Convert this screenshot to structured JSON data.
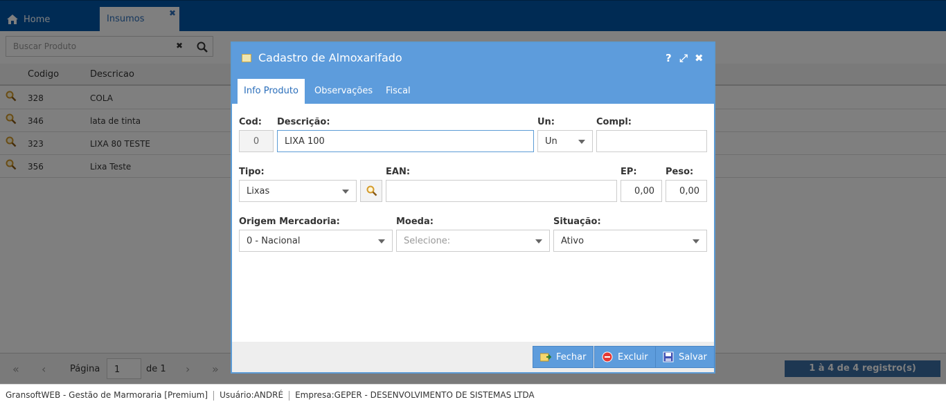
{
  "topbar": {
    "home_label": "Home",
    "active_tab_label": "Insumos"
  },
  "search": {
    "placeholder": "Buscar Produto"
  },
  "grid": {
    "headers": {
      "codigo": "Codigo",
      "descricao": "Descricao"
    },
    "rows": [
      {
        "codigo": "328",
        "descricao": "COLA"
      },
      {
        "codigo": "346",
        "descricao": "lata de tinta"
      },
      {
        "codigo": "323",
        "descricao": "LIXA 80 TESTE"
      },
      {
        "codigo": "356",
        "descricao": "Lixa Teste"
      }
    ]
  },
  "pager": {
    "pagina_label": "Página",
    "page_value": "1",
    "of_label": "de 1",
    "count_label": "1 à 4 de 4 registro(s)"
  },
  "modal": {
    "title": "Cadastro de Almoxarifado",
    "tabs": [
      "Info Produto",
      "Observações",
      "Fiscal"
    ],
    "labels": {
      "cod": "Cod:",
      "descricao": "Descrição:",
      "un": "Un:",
      "compl": "Compl:",
      "tipo": "Tipo:",
      "ean": "EAN:",
      "ep": "EP:",
      "peso": "Peso:",
      "origem": "Origem Mercadoria:",
      "moeda": "Moeda:",
      "situacao": "Situação:"
    },
    "values": {
      "cod": "0",
      "descricao": "LIXA 100",
      "un": "Un",
      "compl": "",
      "tipo": "Lixas",
      "ean": "",
      "ep": "0,00",
      "peso": "0,00",
      "origem": "0 - Nacional",
      "moeda_placeholder": "Selecione:",
      "situacao": "Ativo"
    },
    "buttons": {
      "fechar": "Fechar",
      "excluir": "Excluir",
      "salvar": "Salvar"
    }
  },
  "statusbar": {
    "app": "GransoftWEB - Gestão de Marmoraria [Premium]",
    "usuario": "Usuário:ANDRÉ",
    "empresa": "Empresa:GEPER - DESENVOLVIMENTO DE SISTEMAS LTDA"
  }
}
